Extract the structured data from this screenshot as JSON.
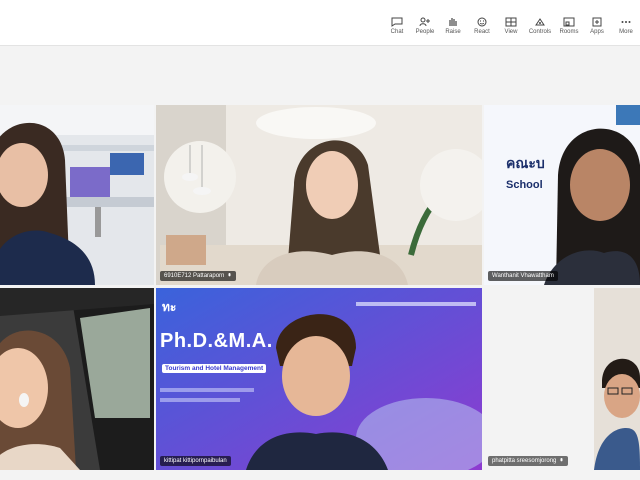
{
  "toolbar": {
    "items": [
      {
        "label": "Chat",
        "icon": "chat-icon"
      },
      {
        "label": "People",
        "icon": "people-icon"
      },
      {
        "label": "Raise",
        "icon": "raise-hand-icon"
      },
      {
        "label": "React",
        "icon": "react-icon"
      },
      {
        "label": "View",
        "icon": "view-icon"
      },
      {
        "label": "Controls",
        "icon": "controls-icon"
      },
      {
        "label": "Rooms",
        "icon": "rooms-icon"
      },
      {
        "label": "Apps",
        "icon": "apps-icon"
      },
      {
        "label": "More",
        "icon": "more-icon"
      }
    ]
  },
  "participants": [
    {
      "name": ""
    },
    {
      "name": "6910E712 Pattaraporn"
    },
    {
      "name": "Wanthanit Vhawattham"
    },
    {
      "name": ""
    },
    {
      "name": "kittipat kittipornpaibulan"
    },
    {
      "name": "phatpitta sreesomjorong"
    },
    {
      "name": ""
    }
  ],
  "poster": {
    "school_label": "School",
    "logo_text": "คณะบ",
    "degree": "Ph.D.&M.A.",
    "program": "Tourism and Hotel Management",
    "logo_glyph": "ทะ"
  },
  "colors": {
    "accent": "#7b83eb",
    "poster_bg": "#4b63d8",
    "toolbar_bg": "#ffffff"
  }
}
